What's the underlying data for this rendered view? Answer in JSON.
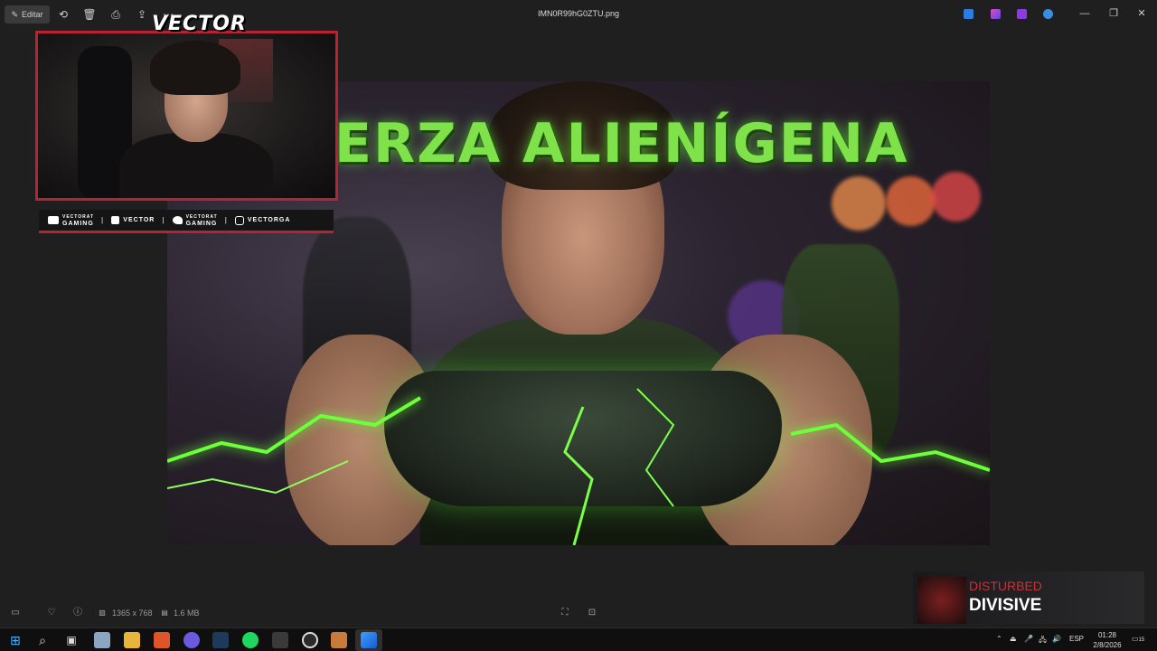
{
  "toolbar": {
    "edit_label": "Editar",
    "tools": [
      "rotate-icon",
      "trash-icon",
      "print-icon",
      "share-icon",
      "more-icon"
    ],
    "file_title": "IMN0R99hG0ZTU.png"
  },
  "thumbnail": {
    "title": "ERZA ALIENÍGENA"
  },
  "webcam": {
    "logo": "VECTOR",
    "socials": [
      {
        "icon": "youtube-icon",
        "top": "VECTORAT",
        "bottom": "GAMING"
      },
      {
        "icon": "twitch-icon",
        "label": "VECTOR"
      },
      {
        "icon": "twitter-icon",
        "top": "VECTORAT",
        "bottom": "GAMING"
      },
      {
        "icon": "instagram-icon",
        "label": "VECTORGA"
      }
    ]
  },
  "infobar": {
    "dimensions": "1365 x 768",
    "size": "1.6 MB"
  },
  "music": {
    "artist": "DISTURBED",
    "track": "DIVISIVE"
  },
  "taskbar": {
    "language": "ESP",
    "time": "01:28",
    "date": "2/8/2026",
    "notifications": "15"
  },
  "colors": {
    "accent_red": "#b82232",
    "title_green": "#7fe24a",
    "bolt_green": "#6dff3a"
  }
}
